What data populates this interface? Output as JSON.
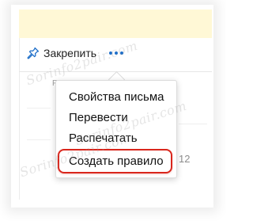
{
  "toolbar": {
    "pin_label": "Закрепить",
    "pin_icon": "pin-icon",
    "more_icon": "more-dots-icon"
  },
  "background": {
    "partial_char": "F",
    "partial_number": "12"
  },
  "menu": {
    "items": [
      {
        "label": "Свойства письма"
      },
      {
        "label": "Перевести"
      },
      {
        "label": "Распечатать"
      },
      {
        "label": "Создать правило",
        "highlighted": true
      }
    ]
  },
  "watermark": {
    "text": "Sorinfo2pair.com"
  },
  "colors": {
    "accent_blue": "#1f6fc9",
    "highlight_red": "#d9261c",
    "band_yellow": "#fff8d6"
  }
}
